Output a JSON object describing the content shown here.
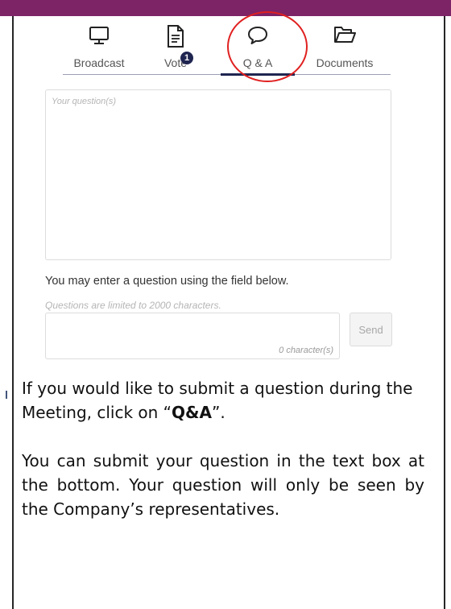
{
  "tabs": [
    {
      "label": "Broadcast",
      "icon": "monitor-icon"
    },
    {
      "label": "Vote",
      "icon": "document-icon",
      "badge": "1"
    },
    {
      "label": "Q & A",
      "icon": "speech-bubble-icon",
      "active": true
    },
    {
      "label": "Documents",
      "icon": "folder-icon"
    }
  ],
  "question_box": {
    "placeholder": "Your question(s)"
  },
  "hint": "You may enter a question using the field below.",
  "limit_note": "Questions are limited to 2000  characters.",
  "char_count": "0 character(s)",
  "send_label": "Send",
  "instructions": {
    "p1_before": "If you would like to submit a question during the Meeting, click on “",
    "p1_bold": "Q&A",
    "p1_after": "”.",
    "p2": "You can submit your question in the text box at the bottom. Your question will only be seen by the Company’s representatives."
  },
  "colors": {
    "header_bar": "#7d2466",
    "accent": "#1f2550",
    "highlight_circle": "#e02020"
  }
}
